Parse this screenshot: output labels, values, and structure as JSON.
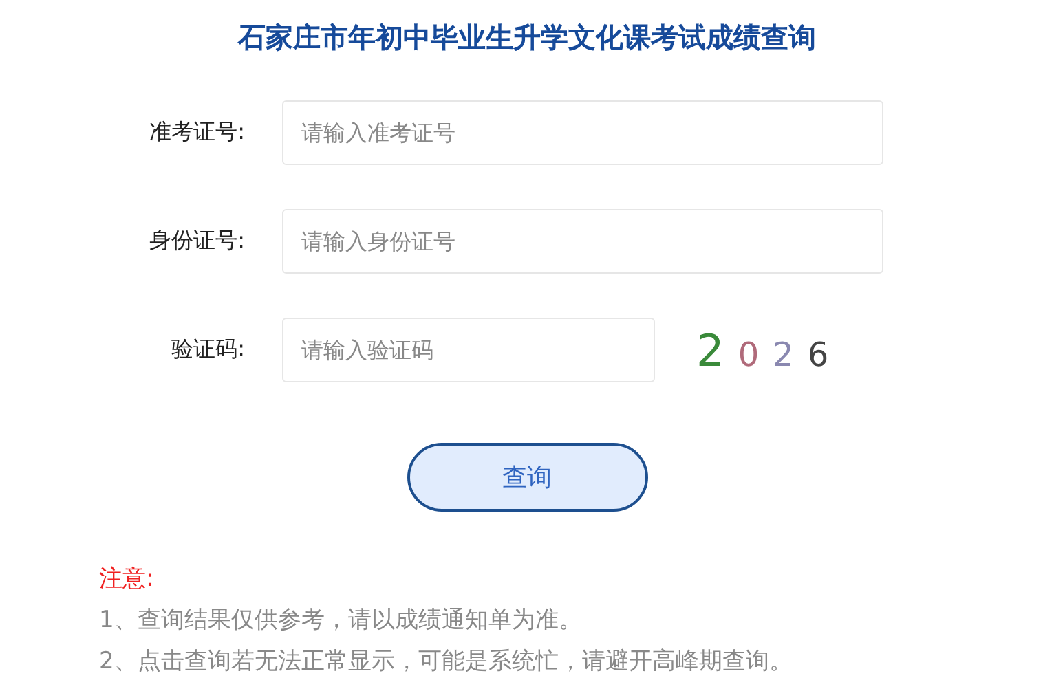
{
  "title": "石家庄市年初中毕业生升学文化课考试成绩查询",
  "fields": [
    {
      "label": "准考证号:",
      "placeholder": "请输入准考证号",
      "kind": "text"
    },
    {
      "label": "身份证号:",
      "placeholder": "请输入身份证号",
      "kind": "text"
    },
    {
      "label": "验证码:",
      "placeholder": "请输入验证码",
      "kind": "captcha",
      "captcha": [
        {
          "char": "2",
          "color": "#3a8a3a"
        },
        {
          "char": "0",
          "color": "#b06a7a"
        },
        {
          "char": "2",
          "color": "#8a88b0"
        },
        {
          "char": "6",
          "color": "#444444"
        }
      ]
    }
  ],
  "button": "查询",
  "notice": {
    "heading": "注意:",
    "lines": [
      "1、查询结果仅供参考，请以成绩通知单为准。",
      "2、点击查询若无法正常显示，可能是系统忙，请避开高峰期查询。"
    ]
  }
}
